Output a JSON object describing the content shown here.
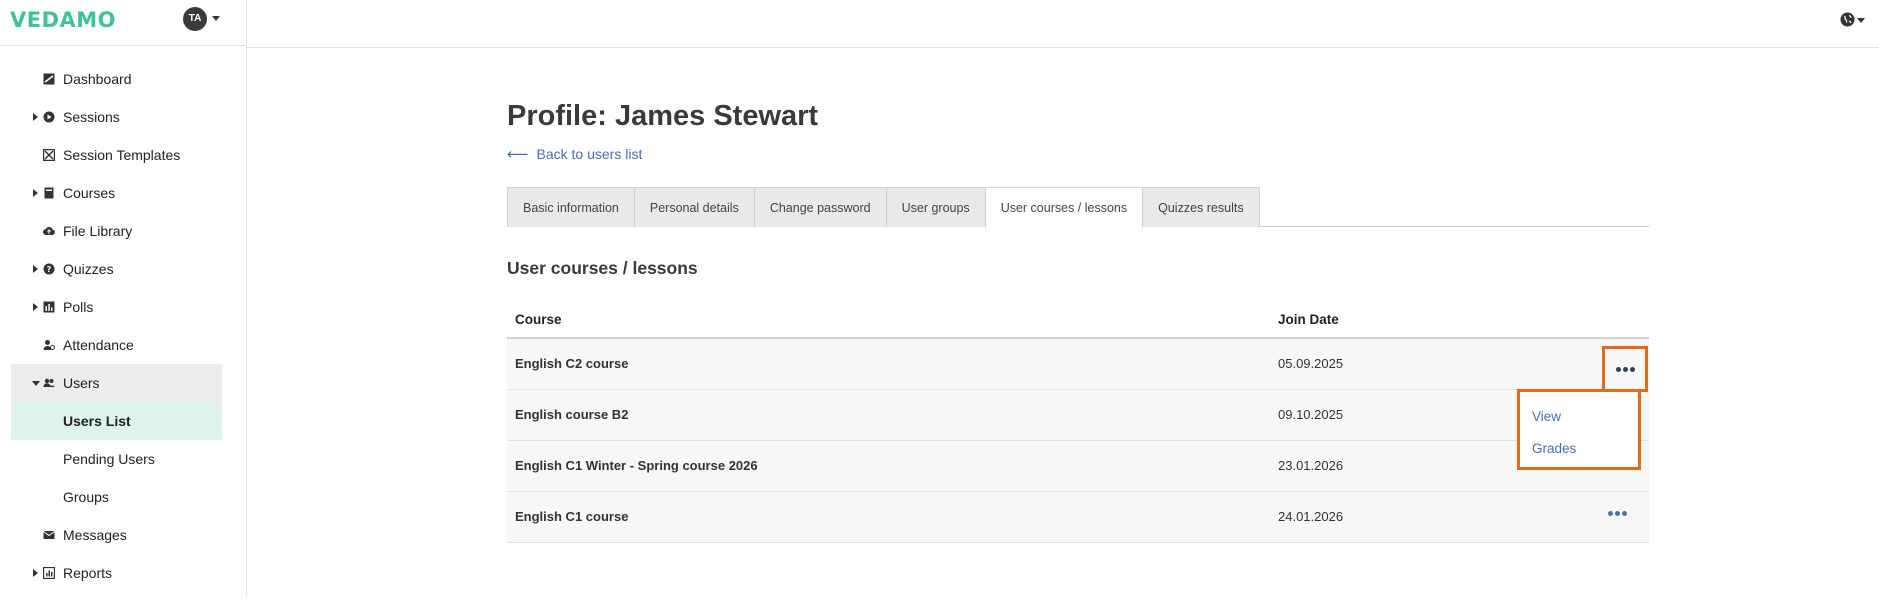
{
  "brand": {
    "logo": "VEDAMO",
    "avatar_initials": "TA"
  },
  "sidebar": {
    "items": [
      {
        "label": "Dashboard",
        "icon": "dashboard-icon",
        "expandable": false
      },
      {
        "label": "Sessions",
        "icon": "play-circle-icon",
        "expandable": true
      },
      {
        "label": "Session Templates",
        "icon": "template-icon",
        "expandable": false
      },
      {
        "label": "Courses",
        "icon": "book-icon",
        "expandable": true
      },
      {
        "label": "File Library",
        "icon": "cloud-upload-icon",
        "expandable": false
      },
      {
        "label": "Quizzes",
        "icon": "question-circle-icon",
        "expandable": true
      },
      {
        "label": "Polls",
        "icon": "poll-chart-icon",
        "expandable": true
      },
      {
        "label": "Attendance",
        "icon": "user-check-icon",
        "expandable": false
      },
      {
        "label": "Users",
        "icon": "users-icon",
        "expandable": true,
        "expanded": true
      },
      {
        "label": "Users List",
        "sub": true,
        "active": true
      },
      {
        "label": "Pending Users",
        "sub": true
      },
      {
        "label": "Groups",
        "sub": true
      },
      {
        "label": "Messages",
        "icon": "envelope-icon",
        "expandable": false
      },
      {
        "label": "Reports",
        "icon": "report-chart-icon",
        "expandable": true
      }
    ]
  },
  "profile": {
    "title": "Profile: James Stewart",
    "back_label": "Back to users list"
  },
  "tabs": [
    {
      "label": "Basic information",
      "active": false
    },
    {
      "label": "Personal details",
      "active": false
    },
    {
      "label": "Change password",
      "active": false
    },
    {
      "label": "User groups",
      "active": false
    },
    {
      "label": "User courses / lessons",
      "active": true
    },
    {
      "label": "Quizzes results",
      "active": false
    }
  ],
  "section": {
    "title": "User courses / lessons"
  },
  "table": {
    "headers": {
      "course": "Course",
      "join_date": "Join Date"
    },
    "rows": [
      {
        "course": "English C2 course",
        "join_date": "05.09.2025"
      },
      {
        "course": "English course B2",
        "join_date": "09.10.2025"
      },
      {
        "course": "English C1 Winter - Spring course 2026",
        "join_date": "23.01.2026"
      },
      {
        "course": "English C1 course",
        "join_date": "24.01.2026"
      }
    ]
  },
  "dropdown": {
    "options": [
      "View",
      "Grades"
    ]
  },
  "colors": {
    "brand": "#3ec29b",
    "link": "#4a6fb0",
    "highlight": "#e16a1c",
    "active_nav": "#def3ea"
  }
}
